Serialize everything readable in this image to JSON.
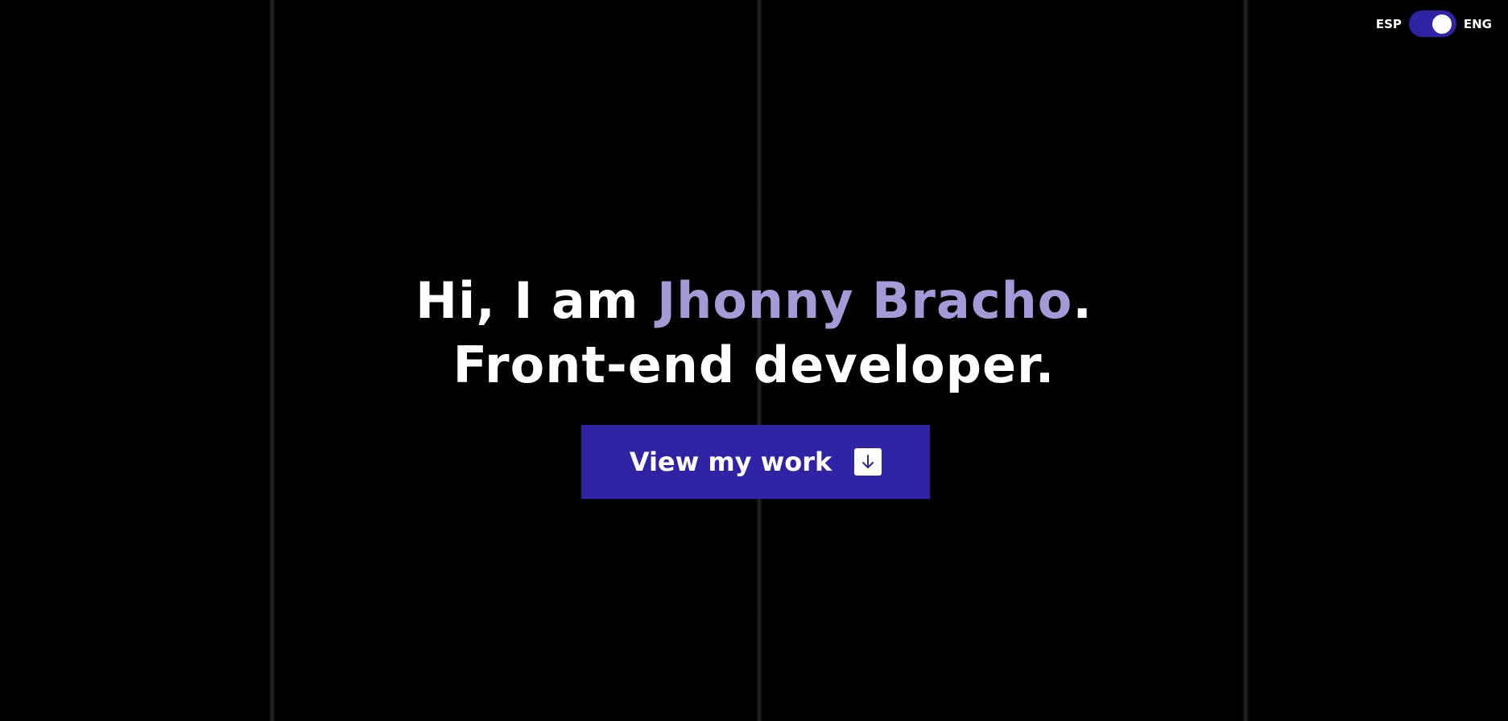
{
  "lang_switch": {
    "left_label": "ESP",
    "right_label": "ENG",
    "selected": "ENG",
    "accent_color": "#3023a6"
  },
  "hero": {
    "greeting": "Hi, I am ",
    "name": "Jhonny Bracho",
    "name_suffix": ".",
    "role": "Front-end developer.",
    "name_color": "#a49ad7"
  },
  "cta": {
    "label": "View my work",
    "icon": "arrow-down-icon",
    "color": "#3023a6"
  }
}
